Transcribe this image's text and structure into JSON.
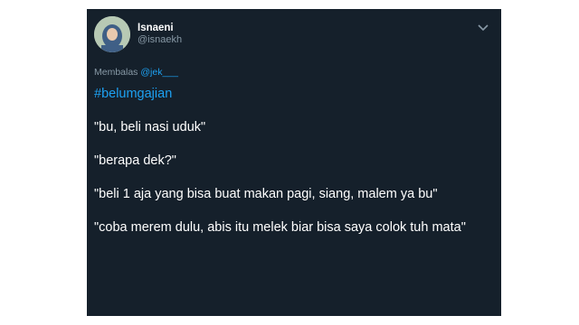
{
  "tweet": {
    "author": {
      "display_name": "Isnaeni",
      "handle": "@isnaekh",
      "avatar_icon": "avatar-hijab-photo"
    },
    "reply": {
      "prefix": "Membalas",
      "mention": "@jek___"
    },
    "hashtag": "#belumgajian",
    "lines": [
      "\"bu, beli nasi uduk\"",
      "\"berapa dek?\"",
      "\"beli 1 aja yang bisa buat makan pagi, siang, malem ya bu\"",
      "\"coba merem dulu, abis itu melek biar bisa saya colok tuh mata\""
    ]
  },
  "colors": {
    "card_background": "#15202b",
    "text": "#ffffff",
    "secondary_text": "#8899a6",
    "accent": "#1da1f2"
  }
}
